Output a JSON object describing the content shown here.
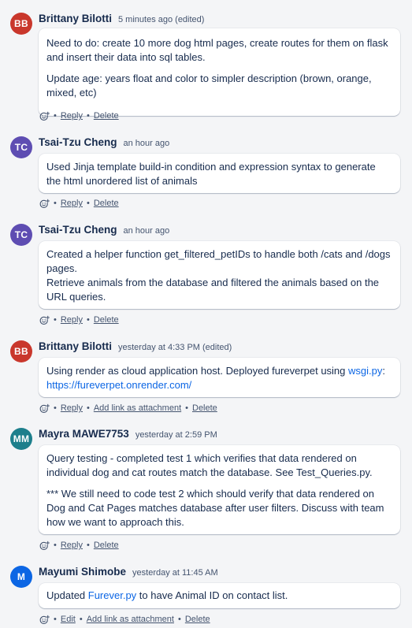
{
  "colors": {
    "accent_link": "#0c66e4",
    "avatar_bb": "#c9372c",
    "avatar_tc": "#5e4db2",
    "avatar_mm": "#1d7f8c",
    "avatar_m": "#0c66e4"
  },
  "comments": [
    {
      "initials": "BB",
      "author": "Brittany Bilotti",
      "time": "5 minutes ago (edited)",
      "p1": "Need to do: create 10 more dog html pages, create routes for them on flask and insert their data into sql tables.",
      "p2": "Update age: years float and color to simpler description (brown, orange, mixed, etc)",
      "actions": {
        "reply": "Reply",
        "delete": "Delete"
      }
    },
    {
      "initials": "TC",
      "author": "Tsai-Tzu Cheng",
      "time": "an hour ago",
      "p1": "Used Jinja template build-in condition and expression syntax to generate the html unordered list of animals",
      "actions": {
        "reply": "Reply",
        "delete": "Delete"
      }
    },
    {
      "initials": "TC",
      "author": "Tsai-Tzu Cheng",
      "time": "an hour ago",
      "line1": "Created a helper function get_filtered_petIDs to handle both /cats and /dogs pages.",
      "line2": "Retrieve animals from the database and filtered the animals based on the URL queries.",
      "actions": {
        "reply": "Reply",
        "delete": "Delete"
      }
    },
    {
      "initials": "BB",
      "author": "Brittany Bilotti",
      "time": "yesterday at 4:33 PM (edited)",
      "text_before": "Using render as cloud application host. Deployed fureverpet using ",
      "link1": "wsgi.py",
      "text_mid": ": ",
      "link2": "https://fureverpet.onrender.com/",
      "actions": {
        "reply": "Reply",
        "attach": "Add link as attachment",
        "delete": "Delete"
      }
    },
    {
      "initials": "MM",
      "author": "Mayra MAWE7753",
      "time": "yesterday at 2:59 PM",
      "p1": "Query testing - completed test 1 which verifies that data rendered on individual dog and cat routes match the database. See Test_Queries.py.",
      "p2": "*** We still need to code test 2 which should verify that data rendered on Dog and Cat Pages matches database after user filters. Discuss with team how we want to approach this.",
      "actions": {
        "reply": "Reply",
        "delete": "Delete"
      }
    },
    {
      "initials": "M",
      "author": "Mayumi Shimobe",
      "time": "yesterday at 11:45 AM",
      "text_before": "Updated ",
      "link1": "Furever.py",
      "text_after": " to have Animal ID on contact list.",
      "actions": {
        "edit": "Edit",
        "attach": "Add link as attachment",
        "delete": "Delete"
      }
    }
  ],
  "icons": {
    "emoji_reaction": "smiley-add-icon",
    "separator": "•"
  }
}
